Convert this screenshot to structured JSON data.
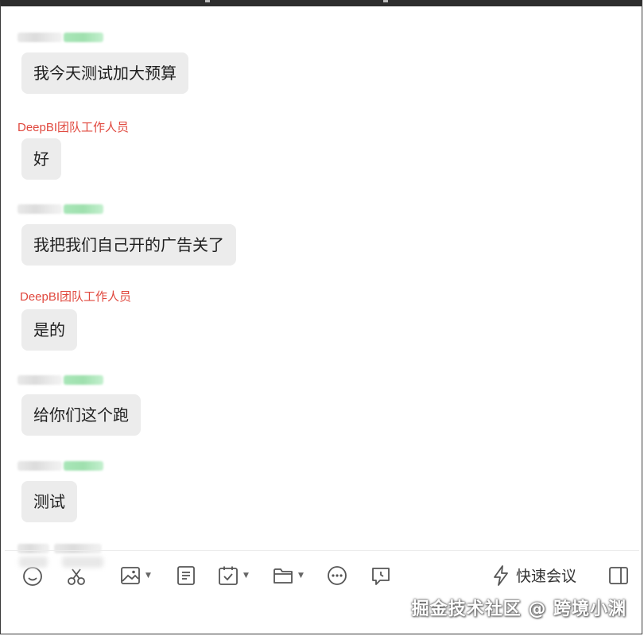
{
  "messages": [
    {
      "sender_type": "customer",
      "text": "我今天测试加大预算"
    },
    {
      "sender_type": "staff",
      "sender_name": "DeepBI团队工作人员",
      "text": "好"
    },
    {
      "sender_type": "customer",
      "text": "我把我们自己开的广告关了"
    },
    {
      "sender_type": "staff",
      "sender_name": "DeepBI团队工作人员",
      "text": "是的"
    },
    {
      "sender_type": "customer",
      "text": "给你们这个跑"
    },
    {
      "sender_type": "customer",
      "text": "测试"
    }
  ],
  "toolbar": {
    "quick_meeting_label": "快速会议",
    "icons": [
      "emoji-icon",
      "scissors-icon",
      "image-icon",
      "document-icon",
      "task-icon",
      "folder-icon",
      "more-icon",
      "schedule-message-icon",
      "lightning-icon",
      "side-panel-icon"
    ]
  },
  "watermark": "掘金技术社区 @ 跨境小渊",
  "colors": {
    "staff_name": "#e0483e",
    "bubble": "#ececec"
  }
}
